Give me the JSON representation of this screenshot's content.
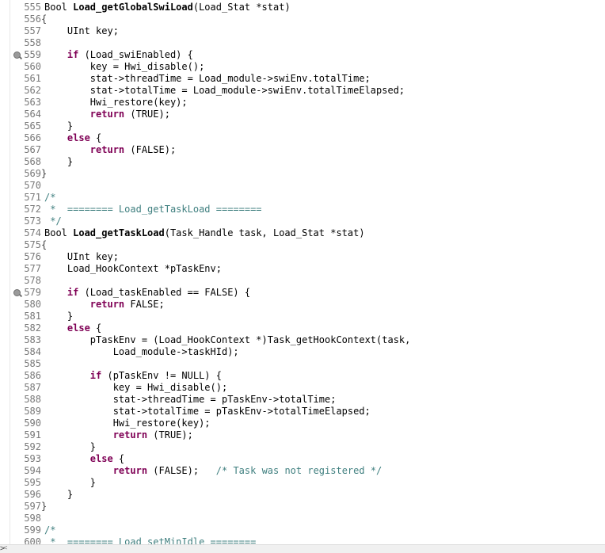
{
  "editor": {
    "lines": [
      {
        "n": "555",
        "fold": "",
        "marker": false,
        "tokens": [
          {
            "t": "",
            "v": "Bool "
          },
          {
            "t": "fn",
            "v": "Load_getGlobalSwiLoad"
          },
          {
            "t": "",
            "v": "(Load_Stat *stat)"
          }
        ]
      },
      {
        "n": "556",
        "fold": "{",
        "marker": false,
        "tokens": []
      },
      {
        "n": "557",
        "fold": "",
        "marker": false,
        "tokens": [
          {
            "t": "",
            "v": "    UInt key;"
          }
        ]
      },
      {
        "n": "558",
        "fold": "",
        "marker": false,
        "tokens": []
      },
      {
        "n": "559",
        "fold": "",
        "marker": true,
        "tokens": [
          {
            "t": "",
            "v": "    "
          },
          {
            "t": "kw",
            "v": "if"
          },
          {
            "t": "",
            "v": " (Load_swiEnabled) {"
          }
        ]
      },
      {
        "n": "560",
        "fold": "",
        "marker": false,
        "tokens": [
          {
            "t": "",
            "v": "        key = Hwi_disable();"
          }
        ]
      },
      {
        "n": "561",
        "fold": "",
        "marker": false,
        "tokens": [
          {
            "t": "",
            "v": "        stat->threadTime = Load_module->swiEnv.totalTime;"
          }
        ]
      },
      {
        "n": "562",
        "fold": "",
        "marker": false,
        "tokens": [
          {
            "t": "",
            "v": "        stat->totalTime = Load_module->swiEnv.totalTimeElapsed;"
          }
        ]
      },
      {
        "n": "563",
        "fold": "",
        "marker": false,
        "tokens": [
          {
            "t": "",
            "v": "        Hwi_restore(key);"
          }
        ]
      },
      {
        "n": "564",
        "fold": "",
        "marker": false,
        "tokens": [
          {
            "t": "",
            "v": "        "
          },
          {
            "t": "kw",
            "v": "return"
          },
          {
            "t": "",
            "v": " (TRUE);"
          }
        ]
      },
      {
        "n": "565",
        "fold": "",
        "marker": false,
        "tokens": [
          {
            "t": "",
            "v": "    }"
          }
        ]
      },
      {
        "n": "566",
        "fold": "",
        "marker": false,
        "tokens": [
          {
            "t": "",
            "v": "    "
          },
          {
            "t": "kw",
            "v": "else"
          },
          {
            "t": "",
            "v": " {"
          }
        ]
      },
      {
        "n": "567",
        "fold": "",
        "marker": false,
        "tokens": [
          {
            "t": "",
            "v": "        "
          },
          {
            "t": "kw",
            "v": "return"
          },
          {
            "t": "",
            "v": " (FALSE);"
          }
        ]
      },
      {
        "n": "568",
        "fold": "",
        "marker": false,
        "tokens": [
          {
            "t": "",
            "v": "    }"
          }
        ]
      },
      {
        "n": "569",
        "fold": "}",
        "marker": false,
        "tokens": []
      },
      {
        "n": "570",
        "fold": "",
        "marker": false,
        "tokens": []
      },
      {
        "n": "571",
        "fold": "",
        "marker": false,
        "tokens": [
          {
            "t": "cm",
            "v": "/*"
          }
        ]
      },
      {
        "n": "572",
        "fold": "",
        "marker": false,
        "tokens": [
          {
            "t": "cm",
            "v": " *  ======== Load_getTaskLoad ========"
          }
        ]
      },
      {
        "n": "573",
        "fold": "",
        "marker": false,
        "tokens": [
          {
            "t": "cm",
            "v": " */"
          }
        ]
      },
      {
        "n": "574",
        "fold": "",
        "marker": false,
        "tokens": [
          {
            "t": "",
            "v": "Bool "
          },
          {
            "t": "fn",
            "v": "Load_getTaskLoad"
          },
          {
            "t": "",
            "v": "(Task_Handle task, Load_Stat *stat)"
          }
        ]
      },
      {
        "n": "575",
        "fold": "{",
        "marker": false,
        "tokens": []
      },
      {
        "n": "576",
        "fold": "",
        "marker": false,
        "tokens": [
          {
            "t": "",
            "v": "    UInt key;"
          }
        ]
      },
      {
        "n": "577",
        "fold": "",
        "marker": false,
        "tokens": [
          {
            "t": "",
            "v": "    Load_HookContext *pTaskEnv;"
          }
        ]
      },
      {
        "n": "578",
        "fold": "",
        "marker": false,
        "tokens": []
      },
      {
        "n": "579",
        "fold": "",
        "marker": true,
        "tokens": [
          {
            "t": "",
            "v": "    "
          },
          {
            "t": "kw",
            "v": "if"
          },
          {
            "t": "",
            "v": " (Load_taskEnabled == FALSE) {"
          }
        ]
      },
      {
        "n": "580",
        "fold": "",
        "marker": false,
        "tokens": [
          {
            "t": "",
            "v": "        "
          },
          {
            "t": "kw",
            "v": "return"
          },
          {
            "t": "",
            "v": " FALSE;"
          }
        ]
      },
      {
        "n": "581",
        "fold": "",
        "marker": false,
        "tokens": [
          {
            "t": "",
            "v": "    }"
          }
        ]
      },
      {
        "n": "582",
        "fold": "",
        "marker": false,
        "tokens": [
          {
            "t": "",
            "v": "    "
          },
          {
            "t": "kw",
            "v": "else"
          },
          {
            "t": "",
            "v": " {"
          }
        ]
      },
      {
        "n": "583",
        "fold": "",
        "marker": false,
        "tokens": [
          {
            "t": "",
            "v": "        pTaskEnv = (Load_HookContext *)Task_getHookContext(task,"
          }
        ]
      },
      {
        "n": "584",
        "fold": "",
        "marker": false,
        "tokens": [
          {
            "t": "",
            "v": "            Load_module->taskHId);"
          }
        ]
      },
      {
        "n": "585",
        "fold": "",
        "marker": false,
        "tokens": []
      },
      {
        "n": "586",
        "fold": "",
        "marker": false,
        "tokens": [
          {
            "t": "",
            "v": "        "
          },
          {
            "t": "kw",
            "v": "if"
          },
          {
            "t": "",
            "v": " (pTaskEnv != NULL) {"
          }
        ]
      },
      {
        "n": "587",
        "fold": "",
        "marker": false,
        "tokens": [
          {
            "t": "",
            "v": "            key = Hwi_disable();"
          }
        ]
      },
      {
        "n": "588",
        "fold": "",
        "marker": false,
        "tokens": [
          {
            "t": "",
            "v": "            stat->threadTime = pTaskEnv->totalTime;"
          }
        ]
      },
      {
        "n": "589",
        "fold": "",
        "marker": false,
        "tokens": [
          {
            "t": "",
            "v": "            stat->totalTime = pTaskEnv->totalTimeElapsed;"
          }
        ]
      },
      {
        "n": "590",
        "fold": "",
        "marker": false,
        "tokens": [
          {
            "t": "",
            "v": "            Hwi_restore(key);"
          }
        ]
      },
      {
        "n": "591",
        "fold": "",
        "marker": false,
        "tokens": [
          {
            "t": "",
            "v": "            "
          },
          {
            "t": "kw",
            "v": "return"
          },
          {
            "t": "",
            "v": " (TRUE);"
          }
        ]
      },
      {
        "n": "592",
        "fold": "",
        "marker": false,
        "tokens": [
          {
            "t": "",
            "v": "        }"
          }
        ]
      },
      {
        "n": "593",
        "fold": "",
        "marker": false,
        "tokens": [
          {
            "t": "",
            "v": "        "
          },
          {
            "t": "kw",
            "v": "else"
          },
          {
            "t": "",
            "v": " {"
          }
        ]
      },
      {
        "n": "594",
        "fold": "",
        "marker": false,
        "tokens": [
          {
            "t": "",
            "v": "            "
          },
          {
            "t": "kw",
            "v": "return"
          },
          {
            "t": "",
            "v": " (FALSE);   "
          },
          {
            "t": "cm",
            "v": "/* Task was not registered */"
          }
        ]
      },
      {
        "n": "595",
        "fold": "",
        "marker": false,
        "tokens": [
          {
            "t": "",
            "v": "        }"
          }
        ]
      },
      {
        "n": "596",
        "fold": "",
        "marker": false,
        "tokens": [
          {
            "t": "",
            "v": "    }"
          }
        ]
      },
      {
        "n": "597",
        "fold": "}",
        "marker": false,
        "tokens": []
      },
      {
        "n": "598",
        "fold": "",
        "marker": false,
        "tokens": []
      },
      {
        "n": "599",
        "fold": "",
        "marker": false,
        "tokens": [
          {
            "t": "cm",
            "v": "/*"
          }
        ]
      },
      {
        "n": "600",
        "fold": "",
        "marker": false,
        "tokens": [
          {
            "t": "cm",
            "v": " *  ======== Load_setMinIdle ========"
          }
        ]
      }
    ]
  },
  "scrollbar": {
    "left_arrow": "<",
    "corner_arrow": ">"
  },
  "colors": {
    "keyword": "#7f0055",
    "comment": "#3f7f7f",
    "line_number": "#787878"
  }
}
